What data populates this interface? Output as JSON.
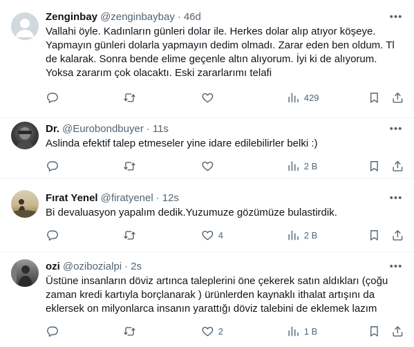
{
  "tweets": [
    {
      "name": "Zenginbay",
      "handle": "@zenginbaybay",
      "time": "46d",
      "text": "Vallahi öyle. Kadınların günleri dolar ile. Herkes dolar alıp atıyor köşeye. Yapmayın günleri dolarla yapmayın dedim olmadı. Zarar eden ben oldum. Tl de kalarak. Sonra bende elime geçenle altın alıyorum. İyi ki de alıyorum. Yoksa zararım çok olacaktı. Eski zararlarımı telafi",
      "reply_count": "",
      "retweet_count": "",
      "like_count": "",
      "view_count": "429"
    },
    {
      "name": "Dr.",
      "handle": "@Eurobondbuyer",
      "time": "11s",
      "text": "Aslinda efektif talep etmeseler yine idare edilebilirler belki :)",
      "reply_count": "",
      "retweet_count": "",
      "like_count": "",
      "view_count": "2 B"
    },
    {
      "name": "Fırat Yenel",
      "handle": "@firatyenel",
      "time": "12s",
      "text": "Bi devaluasyon yapalım dedik.Yuzumuze gözümüze bulastirdik.",
      "reply_count": "",
      "retweet_count": "",
      "like_count": "4",
      "view_count": "2 B"
    },
    {
      "name": "ozi",
      "handle": "@ozibozialpi",
      "time": "2s",
      "text": "Üstüne insanların  döviz artınca taleplerini öne çekerek satın aldıkları  (çoğu zaman kredi kartıyla borçlanarak ) ürünlerden kaynaklı ithalat artışını da eklersek on milyonlarca insanın yarattığı döviz talebini de eklemek lazım",
      "reply_count": "",
      "retweet_count": "",
      "like_count": "2",
      "view_count": "1 B"
    }
  ],
  "separator": "·",
  "icons": {
    "reply": "reply-icon",
    "retweet": "retweet-icon",
    "like": "heart-icon",
    "views": "views-chart-icon",
    "bookmark": "bookmark-icon",
    "share": "share-icon",
    "more": "more-dots-icon"
  },
  "colors": {
    "secondary_text": "#536471",
    "primary_text": "#0f1419",
    "divider": "#eff3f4"
  }
}
